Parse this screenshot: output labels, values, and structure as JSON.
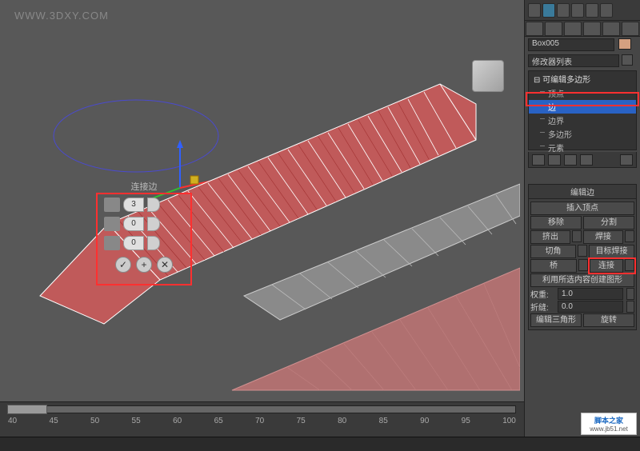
{
  "watermark": "WWW.3DXY.COM",
  "viewcube": {
    "name": "view-cube"
  },
  "caddy": {
    "title": "连接边",
    "segments": "3",
    "pinch": "0",
    "slide": "0",
    "confirm": "✓",
    "apply": "+",
    "cancel": "✕"
  },
  "timeline": {
    "ticks": [
      "40",
      "45",
      "50",
      "55",
      "60",
      "65",
      "70",
      "75",
      "80",
      "85",
      "90",
      "95",
      "100"
    ]
  },
  "rightPanel": {
    "objectName": "Box005",
    "modifierListLabel": "修改器列表",
    "stack": {
      "root": "可编辑多边形",
      "subs": [
        "顶点",
        "边",
        "边界",
        "多边形",
        "元素"
      ],
      "selectedIndex": 1
    },
    "editEdges": {
      "header": "编辑边",
      "insertVertex": "插入顶点",
      "remove": "移除",
      "split": "分割",
      "extrude": "挤出",
      "weld": "焊接",
      "chamfer": "切角",
      "targetWeld": "目标焊接",
      "bridge": "桥",
      "connect": "连接",
      "createShape": "利用所选内容创建图形",
      "weightLabel": "权重:",
      "weightVal": "1.0",
      "creaseLabel": "折缝:",
      "creaseVal": "0.0",
      "editTri": "编辑三角形",
      "turn": "旋转"
    }
  },
  "footerLogo": {
    "line1": "脚本之家",
    "line2": "www.jb51.net"
  },
  "bottomBar": ""
}
